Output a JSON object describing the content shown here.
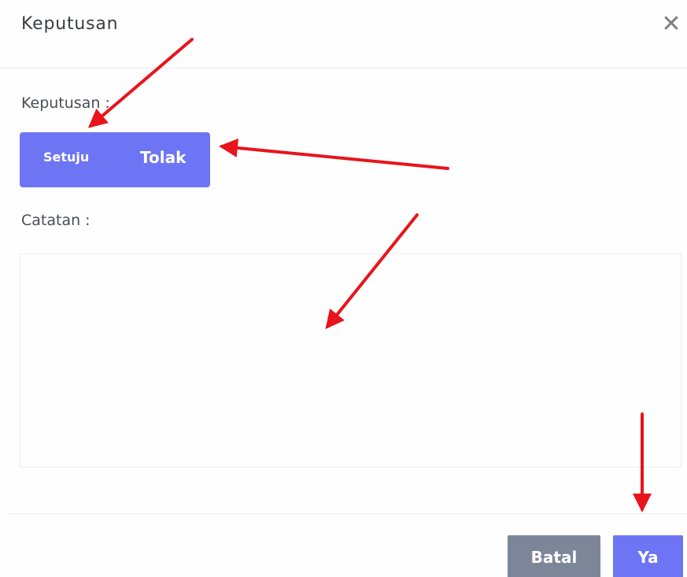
{
  "dialog": {
    "title": "Keputusan",
    "close_glyph": "✕"
  },
  "decision": {
    "label": "Keputusan :",
    "options": [
      "Setuju",
      "Tolak"
    ]
  },
  "notes": {
    "label": "Catatan :",
    "value": ""
  },
  "footer": {
    "cancel_label": "Batal",
    "confirm_label": "Ya"
  },
  "colors": {
    "accent": "#6e75f4",
    "secondary_button": "#7d8699",
    "annotation_arrow": "#e8141b"
  }
}
